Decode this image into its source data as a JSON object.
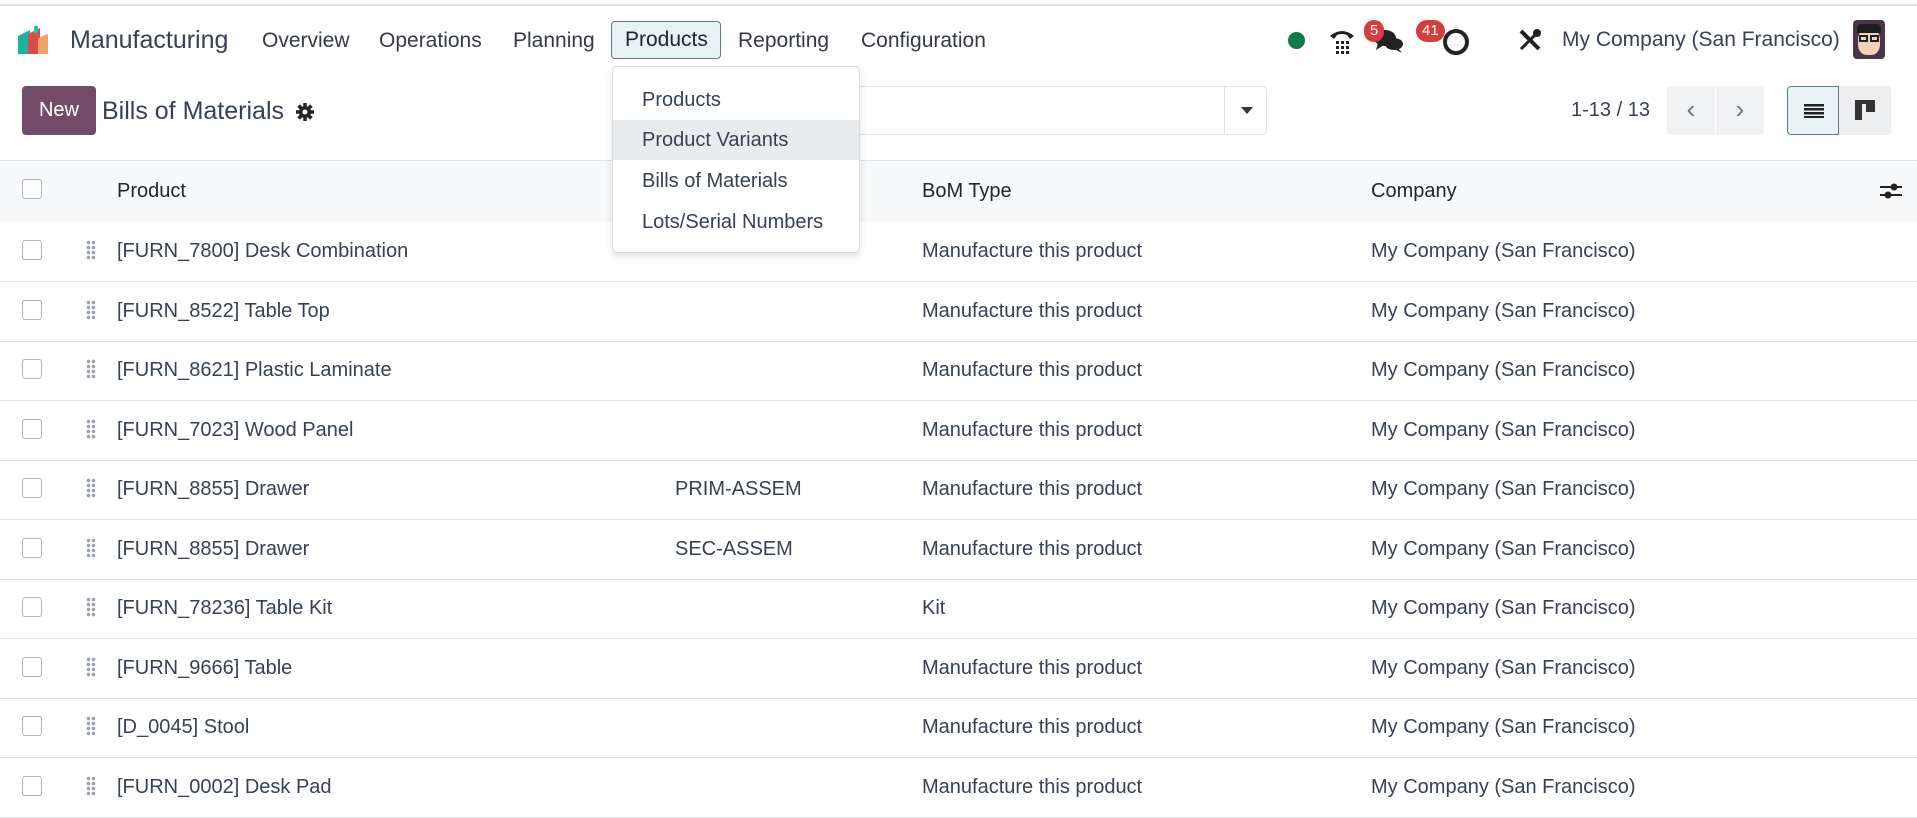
{
  "app": {
    "name": "Manufacturing"
  },
  "nav": {
    "items": [
      "Overview",
      "Operations",
      "Planning",
      "Products",
      "Reporting",
      "Configuration"
    ],
    "active": "Products"
  },
  "products_menu": {
    "items": [
      "Products",
      "Product Variants",
      "Bills of Materials",
      "Lots/Serial Numbers"
    ],
    "highlighted": "Product Variants"
  },
  "systray": {
    "status_color": "#0f7b45",
    "messages_count": "5",
    "activities_count": "41",
    "company": "My Company (San Francisco)"
  },
  "controls": {
    "new_label": "New",
    "title": "Bills of Materials",
    "pager": "1-13 / 13"
  },
  "colors": {
    "primary": "#714b67",
    "badge": "#d63d3d"
  },
  "table": {
    "headers": {
      "product": "Product",
      "bom_type": "BoM Type",
      "company": "Company"
    },
    "rows": [
      {
        "product": "[FURN_7800] Desk Combination",
        "reference": "",
        "bom_type": "Manufacture this product",
        "company": "My Company (San Francisco)"
      },
      {
        "product": "[FURN_8522] Table Top",
        "reference": "",
        "bom_type": "Manufacture this product",
        "company": "My Company (San Francisco)"
      },
      {
        "product": "[FURN_8621] Plastic Laminate",
        "reference": "",
        "bom_type": "Manufacture this product",
        "company": "My Company (San Francisco)"
      },
      {
        "product": "[FURN_7023] Wood Panel",
        "reference": "",
        "bom_type": "Manufacture this product",
        "company": "My Company (San Francisco)"
      },
      {
        "product": "[FURN_8855] Drawer",
        "reference": "PRIM-ASSEM",
        "bom_type": "Manufacture this product",
        "company": "My Company (San Francisco)"
      },
      {
        "product": "[FURN_8855] Drawer",
        "reference": "SEC-ASSEM",
        "bom_type": "Manufacture this product",
        "company": "My Company (San Francisco)"
      },
      {
        "product": "[FURN_78236] Table Kit",
        "reference": "",
        "bom_type": "Kit",
        "company": "My Company (San Francisco)"
      },
      {
        "product": "[FURN_9666] Table",
        "reference": "",
        "bom_type": "Manufacture this product",
        "company": "My Company (San Francisco)"
      },
      {
        "product": "[D_0045] Stool",
        "reference": "",
        "bom_type": "Manufacture this product",
        "company": "My Company (San Francisco)"
      },
      {
        "product": "[FURN_0002] Desk Pad",
        "reference": "",
        "bom_type": "Manufacture this product",
        "company": "My Company (San Francisco)"
      }
    ]
  }
}
